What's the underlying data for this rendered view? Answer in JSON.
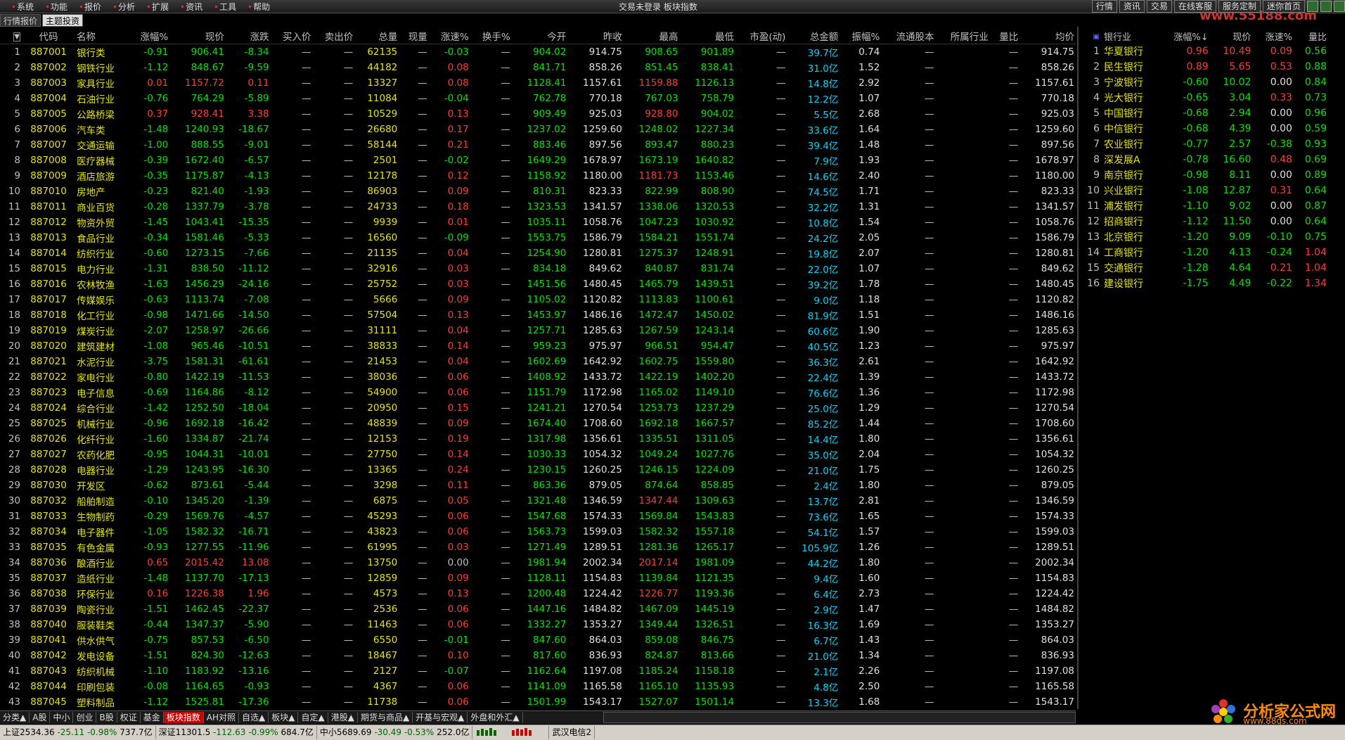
{
  "menu": [
    "系统",
    "功能",
    "报价",
    "分析",
    "扩展",
    "资讯",
    "工具",
    "帮助"
  ],
  "window_title": "交易未登录 板块指数",
  "top_buttons": [
    "行情",
    "资讯",
    "交易",
    "在线客服",
    "服务定制",
    "迷你首页"
  ],
  "watermark": "www.55188.com",
  "tabs": [
    "行情报价",
    "主题投资"
  ],
  "main_headers": [
    "",
    "代码",
    "名称",
    "涨幅%",
    "现价",
    "涨跌",
    "买入价",
    "卖出价",
    "总量",
    "现量",
    "涨速%",
    "换手%",
    "今开",
    "昨收",
    "最高",
    "最低",
    "市盈(动)",
    "总金额",
    "振幅%",
    "流通股本",
    "所属行业",
    "量比",
    "均价"
  ],
  "rows": [
    [
      "1",
      "887001",
      "银行类",
      "-0.91",
      "906.41",
      "-8.34",
      "—",
      "—",
      "62135",
      "—",
      "-0.03",
      "—",
      "904.02",
      "914.75",
      "908.65",
      "901.89",
      "—",
      "39.7亿",
      "0.74",
      "—",
      "",
      "—",
      "914.75"
    ],
    [
      "2",
      "887002",
      "钢铁行业",
      "-1.12",
      "848.67",
      "-9.59",
      "—",
      "—",
      "44182",
      "—",
      "0.08",
      "—",
      "841.71",
      "858.26",
      "851.45",
      "838.41",
      "—",
      "31.0亿",
      "1.52",
      "—",
      "",
      "—",
      "858.26"
    ],
    [
      "3",
      "887003",
      "家具行业",
      "0.01",
      "1157.72",
      "0.11",
      "—",
      "—",
      "13327",
      "—",
      "0.08",
      "—",
      "1128.41",
      "1157.61",
      "1159.88",
      "1126.13",
      "—",
      "14.8亿",
      "2.92",
      "—",
      "",
      "—",
      "1157.61"
    ],
    [
      "4",
      "887004",
      "石油行业",
      "-0.76",
      "764.29",
      "-5.89",
      "—",
      "—",
      "11084",
      "—",
      "-0.04",
      "—",
      "762.78",
      "770.18",
      "767.03",
      "758.79",
      "—",
      "12.2亿",
      "1.07",
      "—",
      "",
      "—",
      "770.18"
    ],
    [
      "5",
      "887005",
      "公路桥梁",
      "0.37",
      "928.41",
      "3.38",
      "—",
      "—",
      "10529",
      "—",
      "0.13",
      "—",
      "909.49",
      "925.03",
      "928.80",
      "904.02",
      "—",
      "5.5亿",
      "2.68",
      "—",
      "",
      "—",
      "925.03"
    ],
    [
      "6",
      "887006",
      "汽车类",
      "-1.48",
      "1240.93",
      "-18.67",
      "—",
      "—",
      "26680",
      "—",
      "0.17",
      "—",
      "1237.02",
      "1259.60",
      "1248.02",
      "1227.34",
      "—",
      "33.6亿",
      "1.64",
      "—",
      "",
      "—",
      "1259.60"
    ],
    [
      "7",
      "887007",
      "交通运输",
      "-1.00",
      "888.55",
      "-9.01",
      "—",
      "—",
      "58144",
      "—",
      "0.21",
      "—",
      "883.46",
      "897.56",
      "893.47",
      "880.23",
      "—",
      "39.4亿",
      "1.48",
      "—",
      "",
      "—",
      "897.56"
    ],
    [
      "8",
      "887008",
      "医疗器械",
      "-0.39",
      "1672.40",
      "-6.57",
      "—",
      "—",
      "2501",
      "—",
      "-0.02",
      "—",
      "1649.29",
      "1678.97",
      "1673.19",
      "1640.82",
      "—",
      "7.9亿",
      "1.93",
      "—",
      "",
      "—",
      "1678.97"
    ],
    [
      "9",
      "887009",
      "酒店旅游",
      "-0.35",
      "1175.87",
      "-4.13",
      "—",
      "—",
      "12178",
      "—",
      "0.12",
      "—",
      "1158.92",
      "1180.00",
      "1181.73",
      "1153.46",
      "—",
      "14.6亿",
      "2.40",
      "—",
      "",
      "—",
      "1180.00"
    ],
    [
      "10",
      "887010",
      "房地产",
      "-0.23",
      "821.40",
      "-1.93",
      "—",
      "—",
      "86903",
      "—",
      "0.09",
      "—",
      "810.31",
      "823.33",
      "822.99",
      "808.90",
      "—",
      "74.5亿",
      "1.71",
      "—",
      "",
      "—",
      "823.33"
    ],
    [
      "11",
      "887011",
      "商业百货",
      "-0.28",
      "1337.79",
      "-3.78",
      "—",
      "—",
      "24733",
      "—",
      "0.18",
      "—",
      "1323.53",
      "1341.57",
      "1338.06",
      "1320.53",
      "—",
      "32.2亿",
      "1.31",
      "—",
      "",
      "—",
      "1341.57"
    ],
    [
      "12",
      "887012",
      "物资外贸",
      "-1.45",
      "1043.41",
      "-15.35",
      "—",
      "—",
      "9939",
      "—",
      "0.01",
      "—",
      "1035.11",
      "1058.76",
      "1047.23",
      "1030.92",
      "—",
      "10.8亿",
      "1.54",
      "—",
      "",
      "—",
      "1058.76"
    ],
    [
      "13",
      "887013",
      "食品行业",
      "-0.34",
      "1581.46",
      "-5.33",
      "—",
      "—",
      "16560",
      "—",
      "-0.09",
      "—",
      "1553.75",
      "1586.79",
      "1584.21",
      "1551.74",
      "—",
      "24.2亿",
      "2.05",
      "—",
      "",
      "—",
      "1586.79"
    ],
    [
      "14",
      "887014",
      "纺织行业",
      "-0.60",
      "1273.15",
      "-7.66",
      "—",
      "—",
      "21135",
      "—",
      "0.04",
      "—",
      "1254.90",
      "1280.81",
      "1275.37",
      "1248.91",
      "—",
      "19.8亿",
      "2.07",
      "—",
      "",
      "—",
      "1280.81"
    ],
    [
      "15",
      "887015",
      "电力行业",
      "-1.31",
      "838.50",
      "-11.12",
      "—",
      "—",
      "32916",
      "—",
      "0.03",
      "—",
      "834.18",
      "849.62",
      "840.87",
      "831.74",
      "—",
      "22.0亿",
      "1.07",
      "—",
      "",
      "—",
      "849.62"
    ],
    [
      "16",
      "887016",
      "农林牧渔",
      "-1.63",
      "1456.29",
      "-24.16",
      "—",
      "—",
      "25752",
      "—",
      "0.03",
      "—",
      "1451.56",
      "1480.45",
      "1465.79",
      "1439.51",
      "—",
      "39.2亿",
      "1.78",
      "—",
      "",
      "—",
      "1480.45"
    ],
    [
      "17",
      "887017",
      "传媒娱乐",
      "-0.63",
      "1113.74",
      "-7.08",
      "—",
      "—",
      "5666",
      "—",
      "0.09",
      "—",
      "1105.02",
      "1120.82",
      "1113.83",
      "1100.61",
      "—",
      "9.0亿",
      "1.18",
      "—",
      "",
      "—",
      "1120.82"
    ],
    [
      "18",
      "887018",
      "化工行业",
      "-0.98",
      "1471.66",
      "-14.50",
      "—",
      "—",
      "57504",
      "—",
      "0.13",
      "—",
      "1453.97",
      "1486.16",
      "1472.47",
      "1450.02",
      "—",
      "81.9亿",
      "1.51",
      "—",
      "",
      "—",
      "1486.16"
    ],
    [
      "19",
      "887019",
      "煤炭行业",
      "-2.07",
      "1258.97",
      "-26.66",
      "—",
      "—",
      "31111",
      "—",
      "0.04",
      "—",
      "1257.71",
      "1285.63",
      "1267.59",
      "1243.14",
      "—",
      "60.6亿",
      "1.90",
      "—",
      "",
      "—",
      "1285.63"
    ],
    [
      "20",
      "887020",
      "建筑建材",
      "-1.08",
      "965.46",
      "-10.51",
      "—",
      "—",
      "38833",
      "—",
      "0.14",
      "—",
      "959.23",
      "975.97",
      "966.51",
      "954.47",
      "—",
      "40.5亿",
      "1.23",
      "—",
      "",
      "—",
      "975.97"
    ],
    [
      "21",
      "887021",
      "水泥行业",
      "-3.75",
      "1581.31",
      "-61.61",
      "—",
      "—",
      "21453",
      "—",
      "0.04",
      "—",
      "1602.69",
      "1642.92",
      "1602.75",
      "1559.80",
      "—",
      "36.3亿",
      "2.61",
      "—",
      "",
      "—",
      "1642.92"
    ],
    [
      "22",
      "887022",
      "家电行业",
      "-0.80",
      "1422.19",
      "-11.53",
      "—",
      "—",
      "38036",
      "—",
      "0.06",
      "—",
      "1408.92",
      "1433.72",
      "1422.19",
      "1402.20",
      "—",
      "22.4亿",
      "1.39",
      "—",
      "",
      "—",
      "1433.72"
    ],
    [
      "23",
      "887023",
      "电子信息",
      "-0.69",
      "1164.86",
      "-8.12",
      "—",
      "—",
      "54900",
      "—",
      "0.06",
      "—",
      "1151.79",
      "1172.98",
      "1165.02",
      "1149.10",
      "—",
      "76.6亿",
      "1.36",
      "—",
      "",
      "—",
      "1172.98"
    ],
    [
      "24",
      "887024",
      "综合行业",
      "-1.42",
      "1252.50",
      "-18.04",
      "—",
      "—",
      "20950",
      "—",
      "0.15",
      "—",
      "1241.21",
      "1270.54",
      "1253.73",
      "1237.29",
      "—",
      "25.0亿",
      "1.29",
      "—",
      "",
      "—",
      "1270.54"
    ],
    [
      "25",
      "887025",
      "机械行业",
      "-0.96",
      "1692.18",
      "-16.42",
      "—",
      "—",
      "48839",
      "—",
      "0.09",
      "—",
      "1674.40",
      "1708.60",
      "1692.18",
      "1667.57",
      "—",
      "85.2亿",
      "1.44",
      "—",
      "",
      "—",
      "1708.60"
    ],
    [
      "26",
      "887026",
      "化纤行业",
      "-1.60",
      "1334.87",
      "-21.74",
      "—",
      "—",
      "12153",
      "—",
      "0.19",
      "—",
      "1317.98",
      "1356.61",
      "1335.51",
      "1311.05",
      "—",
      "14.4亿",
      "1.80",
      "—",
      "",
      "—",
      "1356.61"
    ],
    [
      "27",
      "887027",
      "农药化肥",
      "-0.95",
      "1044.31",
      "-10.01",
      "—",
      "—",
      "27750",
      "—",
      "0.14",
      "—",
      "1030.33",
      "1054.32",
      "1049.24",
      "1027.76",
      "—",
      "35.0亿",
      "2.04",
      "—",
      "",
      "—",
      "1054.32"
    ],
    [
      "28",
      "887028",
      "电器行业",
      "-1.29",
      "1243.95",
      "-16.30",
      "—",
      "—",
      "13365",
      "—",
      "0.24",
      "—",
      "1230.15",
      "1260.25",
      "1246.15",
      "1224.09",
      "—",
      "21.0亿",
      "1.75",
      "—",
      "",
      "—",
      "1260.25"
    ],
    [
      "29",
      "887030",
      "开发区",
      "-0.62",
      "873.61",
      "-5.44",
      "—",
      "—",
      "3298",
      "—",
      "0.11",
      "—",
      "863.36",
      "879.05",
      "874.64",
      "858.85",
      "—",
      "2.4亿",
      "1.80",
      "—",
      "",
      "—",
      "879.05"
    ],
    [
      "30",
      "887032",
      "船舶制造",
      "-0.10",
      "1345.20",
      "-1.39",
      "—",
      "—",
      "6875",
      "—",
      "0.05",
      "—",
      "1321.48",
      "1346.59",
      "1347.44",
      "1309.63",
      "—",
      "13.7亿",
      "2.81",
      "—",
      "",
      "—",
      "1346.59"
    ],
    [
      "31",
      "887033",
      "生物制药",
      "-0.29",
      "1569.76",
      "-4.57",
      "—",
      "—",
      "45293",
      "—",
      "0.06",
      "—",
      "1547.68",
      "1574.33",
      "1569.84",
      "1543.83",
      "—",
      "73.6亿",
      "1.65",
      "—",
      "",
      "—",
      "1574.33"
    ],
    [
      "32",
      "887034",
      "电子器件",
      "-1.05",
      "1582.32",
      "-16.71",
      "—",
      "—",
      "43823",
      "—",
      "0.06",
      "—",
      "1563.73",
      "1599.03",
      "1582.32",
      "1557.18",
      "—",
      "54.1亿",
      "1.57",
      "—",
      "",
      "—",
      "1599.03"
    ],
    [
      "33",
      "887035",
      "有色金属",
      "-0.93",
      "1277.55",
      "-11.96",
      "—",
      "—",
      "61995",
      "—",
      "0.03",
      "—",
      "1271.49",
      "1289.51",
      "1281.36",
      "1265.17",
      "—",
      "105.9亿",
      "1.26",
      "—",
      "",
      "—",
      "1289.51"
    ],
    [
      "34",
      "887036",
      "酿酒行业",
      "0.65",
      "2015.42",
      "13.08",
      "—",
      "—",
      "13750",
      "—",
      "0.00",
      "—",
      "1981.94",
      "2002.34",
      "2017.14",
      "1981.09",
      "—",
      "44.2亿",
      "1.80",
      "—",
      "",
      "—",
      "2002.34"
    ],
    [
      "35",
      "887037",
      "造纸行业",
      "-1.48",
      "1137.70",
      "-17.13",
      "—",
      "—",
      "12859",
      "—",
      "0.09",
      "—",
      "1128.11",
      "1154.83",
      "1139.84",
      "1121.35",
      "—",
      "9.4亿",
      "1.60",
      "—",
      "",
      "—",
      "1154.83"
    ],
    [
      "36",
      "887038",
      "环保行业",
      "0.16",
      "1226.38",
      "1.96",
      "—",
      "—",
      "4573",
      "—",
      "0.13",
      "—",
      "1200.48",
      "1224.42",
      "1226.77",
      "1193.36",
      "—",
      "6.4亿",
      "2.73",
      "—",
      "",
      "—",
      "1224.42"
    ],
    [
      "37",
      "887039",
      "陶瓷行业",
      "-1.51",
      "1462.45",
      "-22.37",
      "—",
      "—",
      "2536",
      "—",
      "0.06",
      "—",
      "1447.16",
      "1484.82",
      "1467.09",
      "1445.19",
      "—",
      "2.9亿",
      "1.47",
      "—",
      "",
      "—",
      "1484.82"
    ],
    [
      "38",
      "887040",
      "服装鞋类",
      "-0.44",
      "1347.37",
      "-5.90",
      "—",
      "—",
      "11463",
      "—",
      "0.06",
      "—",
      "1332.27",
      "1353.27",
      "1349.44",
      "1326.51",
      "—",
      "16.3亿",
      "1.69",
      "—",
      "",
      "—",
      "1353.27"
    ],
    [
      "39",
      "887041",
      "供水供气",
      "-0.75",
      "857.53",
      "-6.50",
      "—",
      "—",
      "6550",
      "—",
      "-0.01",
      "—",
      "847.60",
      "864.03",
      "859.08",
      "846.75",
      "—",
      "6.7亿",
      "1.43",
      "—",
      "",
      "—",
      "864.03"
    ],
    [
      "40",
      "887042",
      "发电设备",
      "-1.51",
      "824.30",
      "-12.63",
      "—",
      "—",
      "18467",
      "—",
      "0.10",
      "—",
      "817.60",
      "836.93",
      "824.87",
      "813.66",
      "—",
      "21.0亿",
      "1.34",
      "—",
      "",
      "—",
      "836.93"
    ],
    [
      "41",
      "887043",
      "纺织机械",
      "-1.10",
      "1183.92",
      "-13.16",
      "—",
      "—",
      "2127",
      "—",
      "-0.07",
      "—",
      "1162.64",
      "1197.08",
      "1185.24",
      "1158.18",
      "—",
      "2.1亿",
      "2.26",
      "—",
      "",
      "—",
      "1197.08"
    ],
    [
      "42",
      "887044",
      "印刷包装",
      "-0.08",
      "1164.65",
      "-0.93",
      "—",
      "—",
      "4367",
      "—",
      "0.06",
      "—",
      "1141.09",
      "1165.58",
      "1165.10",
      "1135.93",
      "—",
      "4.8亿",
      "2.50",
      "—",
      "",
      "—",
      "1165.58"
    ],
    [
      "43",
      "887045",
      "塑料制品",
      "-1.12",
      "1525.81",
      "-17.36",
      "—",
      "—",
      "11738",
      "—",
      "0.06",
      "—",
      "1501.99",
      "1543.17",
      "1527.07",
      "1501.14",
      "—",
      "13.3亿",
      "1.68",
      "—",
      "",
      "—",
      "1543.17"
    ]
  ],
  "side_headers": [
    "",
    "银行业",
    "涨幅%↓",
    "现价",
    "涨速%",
    "量比"
  ],
  "side_rows": [
    [
      "1",
      "华夏银行",
      "0.96",
      "10.49",
      "0.09",
      "0.56"
    ],
    [
      "2",
      "民生银行",
      "0.89",
      "5.65",
      "0.53",
      "0.88"
    ],
    [
      "3",
      "宁波银行",
      "-0.60",
      "10.02",
      "0.00",
      "0.84"
    ],
    [
      "4",
      "光大银行",
      "-0.65",
      "3.04",
      "0.33",
      "0.73"
    ],
    [
      "5",
      "中国银行",
      "-0.68",
      "2.94",
      "0.00",
      "0.96"
    ],
    [
      "6",
      "中信银行",
      "-0.68",
      "4.39",
      "0.00",
      "0.59"
    ],
    [
      "7",
      "农业银行",
      "-0.77",
      "2.57",
      "-0.38",
      "0.93"
    ],
    [
      "8",
      "深发展A",
      "-0.78",
      "16.60",
      "0.48",
      "0.69"
    ],
    [
      "9",
      "南京银行",
      "-0.98",
      "8.11",
      "0.00",
      "0.89"
    ],
    [
      "10",
      "兴业银行",
      "-1.08",
      "12.87",
      "0.31",
      "0.64"
    ],
    [
      "11",
      "浦发银行",
      "-1.10",
      "9.02",
      "0.00",
      "0.87"
    ],
    [
      "12",
      "招商银行",
      "-1.12",
      "11.50",
      "0.00",
      "0.64"
    ],
    [
      "13",
      "北京银行",
      "-1.20",
      "9.09",
      "-0.10",
      "0.75"
    ],
    [
      "14",
      "工商银行",
      "-1.20",
      "4.13",
      "-0.24",
      "1.04"
    ],
    [
      "15",
      "交通银行",
      "-1.28",
      "4.64",
      "0.21",
      "1.04"
    ],
    [
      "16",
      "建设银行",
      "-1.75",
      "4.49",
      "-0.22",
      "1.34"
    ]
  ],
  "bottom_tabs": [
    "分类▲",
    "A股",
    "中小",
    "创业",
    "B股",
    "权证",
    "基金",
    "板块指数",
    "AH对照",
    "自选▲",
    "板块▲",
    "自定▲",
    "港股▲",
    "期货与商品▲",
    "开基与宏观▲",
    "外盘和外汇▲"
  ],
  "status": {
    "sh": "上证2534.36",
    "sh_chg": "-25.11",
    "sh_pct": "-0.98%",
    "sh_amt": "737.7亿",
    "sz": "深证11301.5",
    "sz_chg": "-112.63",
    "sz_pct": "-0.99%",
    "sz_amt": "684.7亿",
    "zx": "中小5689.69",
    "zx_chg": "-30.49",
    "zx_pct": "-0.53%",
    "zx_amt": "252.0亿",
    "server": "武汉电信2"
  },
  "logo": {
    "title": "分析家公式网",
    "url": "www.88gs.com"
  }
}
